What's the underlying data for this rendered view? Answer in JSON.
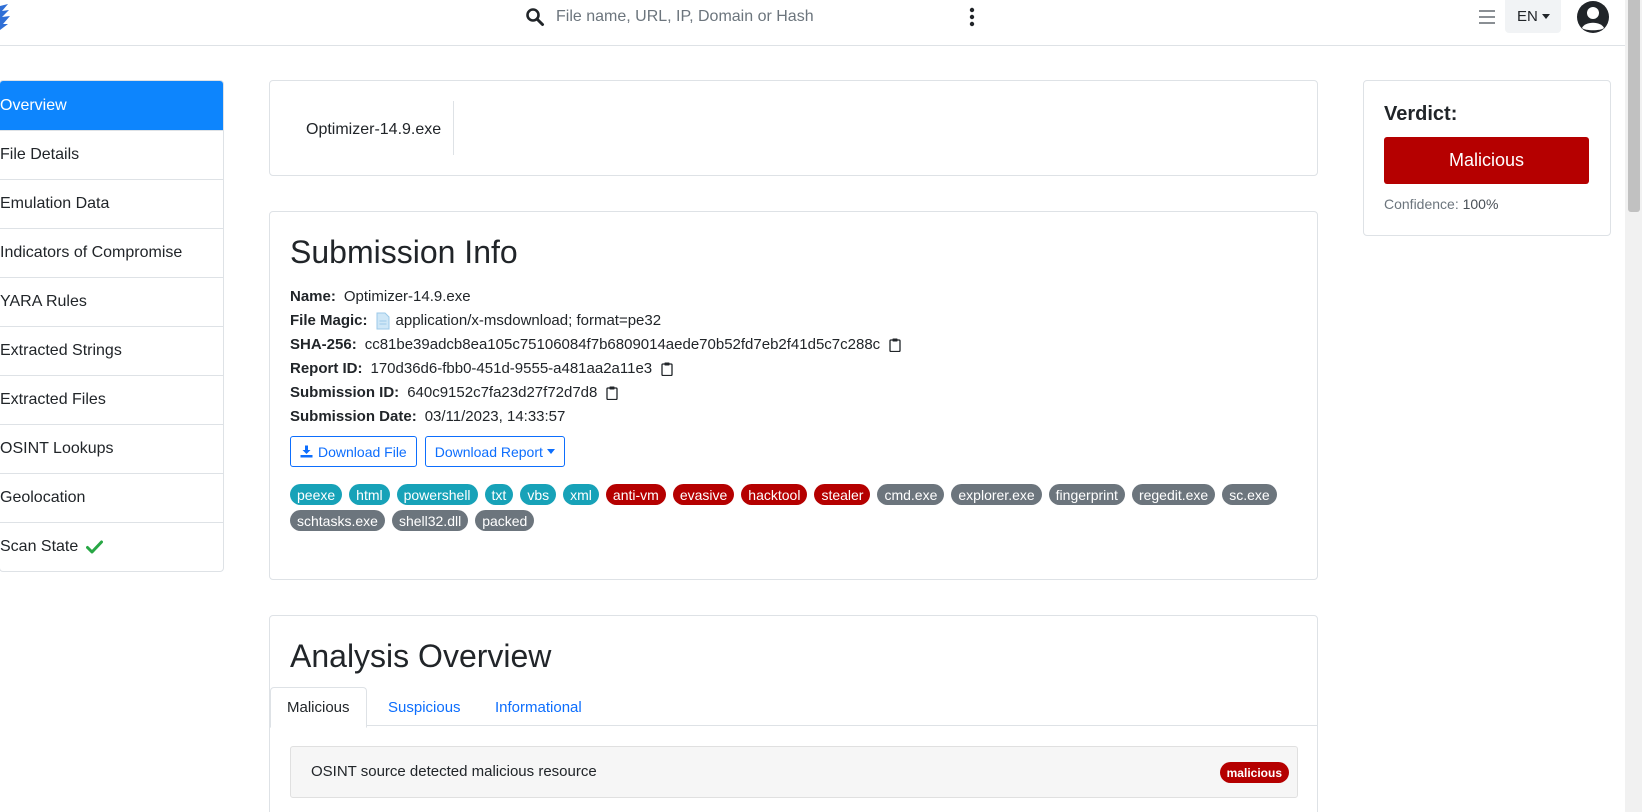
{
  "header": {
    "search_placeholder": "File name, URL, IP, Domain or Hash",
    "language": "EN"
  },
  "sidebar": {
    "items": [
      {
        "label": "Overview"
      },
      {
        "label": "File Details"
      },
      {
        "label": "Emulation Data"
      },
      {
        "label": "Indicators of Compromise"
      },
      {
        "label": "YARA Rules"
      },
      {
        "label": "Extracted Strings"
      },
      {
        "label": "Extracted Files"
      },
      {
        "label": "OSINT Lookups"
      },
      {
        "label": "Geolocation"
      },
      {
        "label": "Scan State"
      }
    ]
  },
  "file": {
    "name": "Optimizer-14.9.exe"
  },
  "verdict": {
    "label": "Verdict:",
    "value": "Malicious",
    "confidence_label": "Confidence:",
    "confidence_value": "100%"
  },
  "submission": {
    "title": "Submission Info",
    "rows": [
      {
        "key": "Name:",
        "value": "Optimizer-14.9.exe"
      },
      {
        "key": "File Magic:",
        "value": "application/x-msdownload; format=pe32"
      },
      {
        "key": "SHA-256:",
        "value": "cc81be39adcb8ea105c75106084f7b6809014aede70b52fd7eb2f41d5c7c288c"
      },
      {
        "key": "Report ID:",
        "value": "170d36d6-fbb0-451d-9555-a481aa2a11e3"
      },
      {
        "key": "Submission ID:",
        "value": "640c9152c7fa23d27f72d7d8"
      },
      {
        "key": "Submission Date:",
        "value": "03/11/2023, 14:33:57"
      }
    ],
    "download_file": "Download File",
    "download_report": "Download Report",
    "tags": [
      {
        "label": "peexe",
        "kind": "info"
      },
      {
        "label": "html",
        "kind": "info"
      },
      {
        "label": "powershell",
        "kind": "info"
      },
      {
        "label": "txt",
        "kind": "info"
      },
      {
        "label": "vbs",
        "kind": "info"
      },
      {
        "label": "xml",
        "kind": "info"
      },
      {
        "label": "anti-vm",
        "kind": "danger"
      },
      {
        "label": "evasive",
        "kind": "danger"
      },
      {
        "label": "hacktool",
        "kind": "danger"
      },
      {
        "label": "stealer",
        "kind": "danger"
      },
      {
        "label": "cmd.exe",
        "kind": "secondary"
      },
      {
        "label": "explorer.exe",
        "kind": "secondary"
      },
      {
        "label": "fingerprint",
        "kind": "secondary"
      },
      {
        "label": "regedit.exe",
        "kind": "secondary"
      },
      {
        "label": "sc.exe",
        "kind": "secondary"
      },
      {
        "label": "schtasks.exe",
        "kind": "secondary"
      },
      {
        "label": "shell32.dll",
        "kind": "secondary"
      },
      {
        "label": "packed",
        "kind": "secondary"
      }
    ]
  },
  "analysis": {
    "title": "Analysis Overview",
    "tabs": [
      "Malicious",
      "Suspicious",
      "Informational"
    ],
    "finding": {
      "text": "OSINT source detected malicious resource",
      "badge": "malicious"
    }
  },
  "colors": {
    "primary": "#0d85fd",
    "danger": "#b50000",
    "info": "#17a2b8",
    "secondary": "#6c757d",
    "success": "#28a745"
  }
}
